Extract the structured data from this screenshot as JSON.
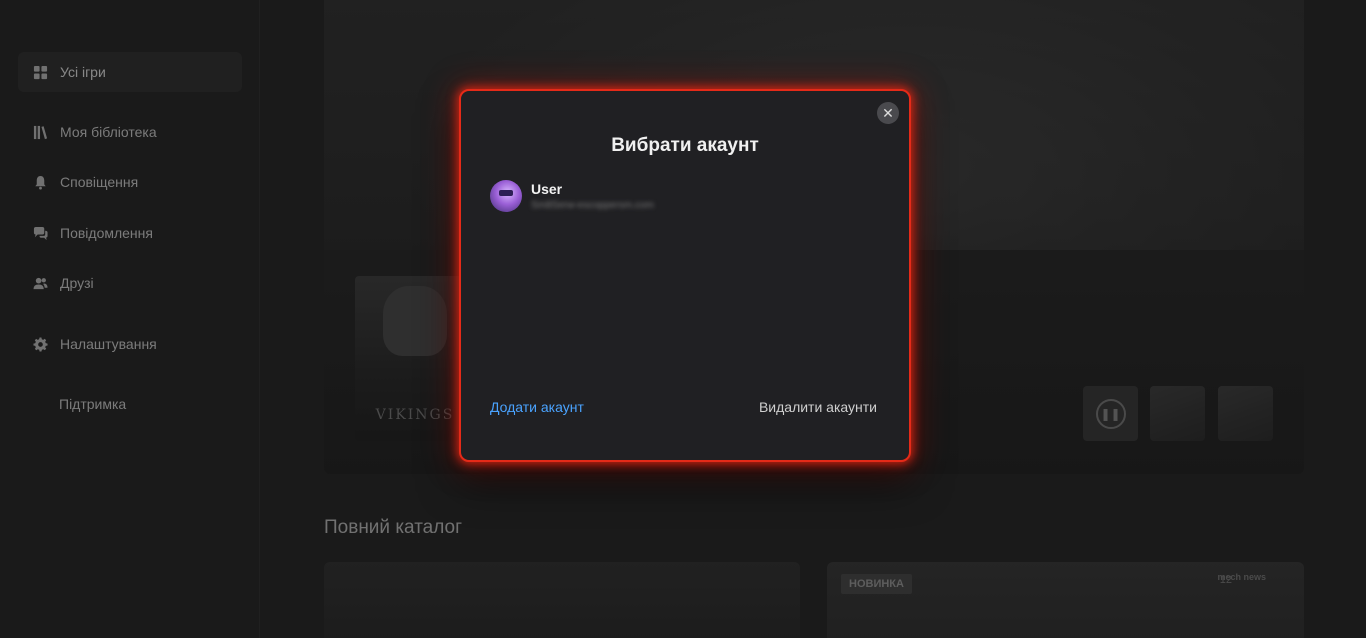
{
  "sidebar": {
    "items": [
      {
        "label": "Усі ігри",
        "icon": "grid-icon",
        "active": true
      },
      {
        "label": "Моя бібліотека",
        "icon": "library-icon"
      },
      {
        "label": "Сповіщення",
        "icon": "bell-icon"
      },
      {
        "label": "Повідомлення",
        "icon": "chat-icon"
      },
      {
        "label": "Друзі",
        "icon": "friends-icon"
      },
      {
        "label": "Налаштування",
        "icon": "gear-icon"
      },
      {
        "label": "Підтримка"
      }
    ]
  },
  "hero": {
    "poster_title": "VIKINGS"
  },
  "catalog": {
    "title": "Повний каталог",
    "cards": [
      {
        "badge": ""
      },
      {
        "badge": "НОВИНКА",
        "logo_num": "12",
        "logo_text": "mech news"
      }
    ]
  },
  "dialog": {
    "title": "Вибрати акаунт",
    "close_label": "✕",
    "account": {
      "name": "User",
      "email": "Sm8Serw-escoppersm.com"
    },
    "add_account": "Додати акаунт",
    "remove_accounts": "Видалити акаунти"
  },
  "colors": {
    "accent_link": "#4aa3ff",
    "dialog_border": "#e52a18"
  }
}
